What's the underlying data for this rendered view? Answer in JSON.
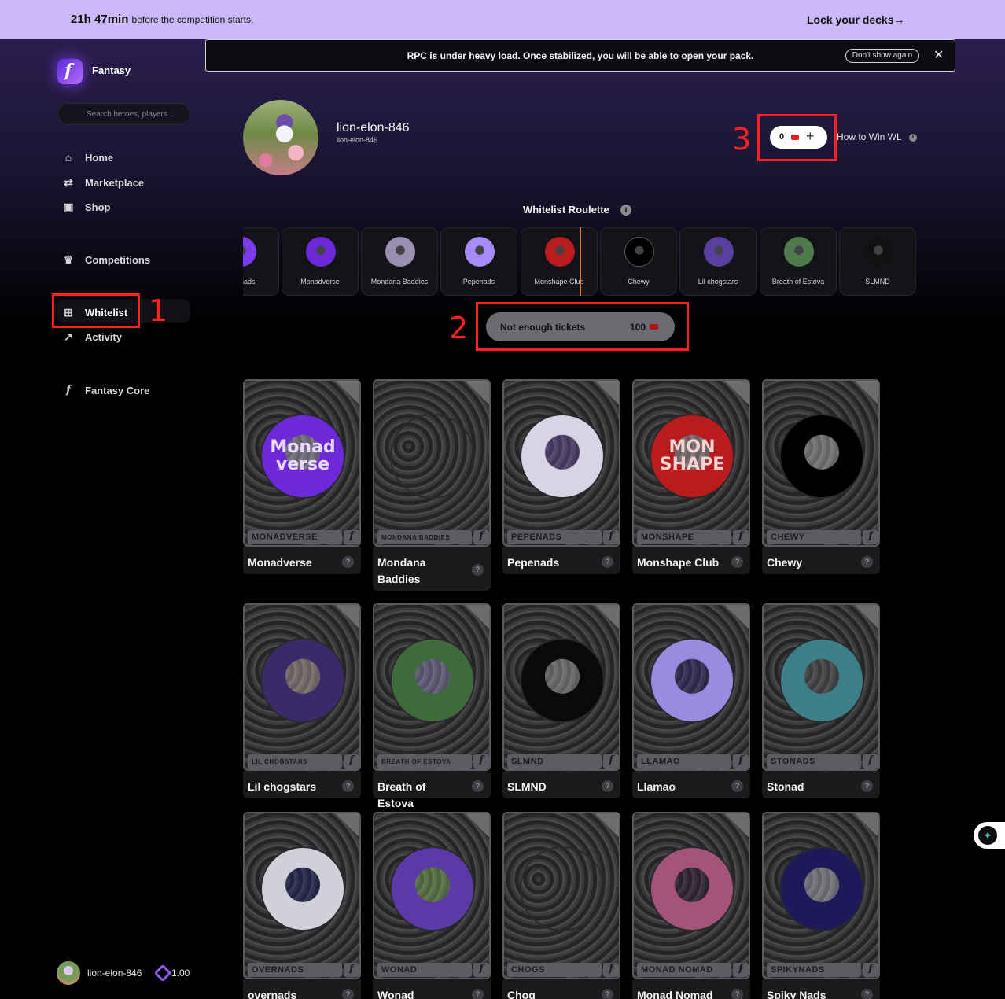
{
  "banner": {
    "countdown": "21h 47min",
    "countdown_suffix": "before the competition starts.",
    "lock_link": "Lock your decks→"
  },
  "sidebar": {
    "brand": "Fantasy",
    "search_placeholder": "Search heroes, players...",
    "nav": [
      {
        "label": "Home",
        "icon": "home-icon"
      },
      {
        "label": "Marketplace",
        "icon": "swap-icon"
      },
      {
        "label": "Shop",
        "icon": "shop-icon"
      },
      {
        "label": "Competitions",
        "icon": "trophy-icon"
      },
      {
        "label": "Whitelist",
        "icon": "gift-icon",
        "active": true
      },
      {
        "label": "Activity",
        "icon": "trending-icon"
      },
      {
        "label": "Fantasy Core",
        "icon": "fantasy-logo-icon"
      }
    ],
    "user": {
      "name": "lion-elon-846",
      "balance": "1.00"
    }
  },
  "notice": {
    "text": "RPC is under heavy load. Once stabilized, you will be able to open your pack.",
    "dismiss_label": "Don't show again",
    "close_glyph": "✕"
  },
  "profile": {
    "name": "lion-elon-846",
    "handle": "lion-elon-846",
    "tickets": "0",
    "plus_glyph": "+",
    "how_to_win": "How to Win WL"
  },
  "roulette": {
    "title": "Whitelist Roulette",
    "items": [
      {
        "name": "overnads",
        "color": "#7c3aed"
      },
      {
        "name": "Monadverse",
        "color": "#6d28d9"
      },
      {
        "name": "Mondana Baddies",
        "color": "#9a8fb0"
      },
      {
        "name": "Pepenads",
        "color": "#a78bfa"
      },
      {
        "name": "Monshape Club",
        "color": "#b91c1c"
      },
      {
        "name": "Chewy",
        "color": "#000000"
      },
      {
        "name": "Lil chogstars",
        "color": "#5b3fa0"
      },
      {
        "name": "Breath of Estova",
        "color": "#4d7c4a"
      },
      {
        "name": "SLMND",
        "color": "#111111"
      }
    ],
    "button_label": "Not enough tickets",
    "button_cost": "100"
  },
  "annotations": [
    "1",
    "2",
    "3"
  ],
  "collections": [
    {
      "name": "Monadverse",
      "plate": "MONADVERSE",
      "art": "Monad verse",
      "bg": "#6d28d9",
      "fg": "#e5d9ff"
    },
    {
      "name": "Mondana Baddies",
      "plate": "MONDANA BADDIES",
      "art": "",
      "bg": "#b5a8c4",
      "fg": "#222"
    },
    {
      "name": "Pepenads",
      "plate": "PEPENADS",
      "art": "",
      "bg": "#d9d4e4",
      "fg": "#7c5cc4"
    },
    {
      "name": "Monshape Club",
      "plate": "MONSHAPE",
      "art": "MON SHAPE",
      "bg": "#b91c1c",
      "fg": "#f4d4d4"
    },
    {
      "name": "Chewy",
      "plate": "CHEWY",
      "art": "",
      "bg": "#000000",
      "fg": "#e5e5e5"
    },
    {
      "name": "Lil chogstars",
      "plate": "LIL CHOGSTARS",
      "art": "",
      "bg": "#3b2a6a",
      "fg": "#f0d6c8"
    },
    {
      "name": "Breath of Estova",
      "plate": "BREATH OF ESTOVA",
      "art": "",
      "bg": "#3f6b3a",
      "fg": "#b0a8e8"
    },
    {
      "name": "SLMND",
      "plate": "SLMND",
      "art": "",
      "bg": "#0a0a0a",
      "fg": "#cfcfcf"
    },
    {
      "name": "Llamao",
      "plate": "LLAMAO",
      "art": "",
      "bg": "#9a8ae0",
      "fg": "#3b2a8a"
    },
    {
      "name": "Stonad",
      "plate": "STONADS",
      "art": "",
      "bg": "#3c7f86",
      "fg": "#6b6b6b"
    },
    {
      "name": "overnads",
      "plate": "OVERNADS",
      "art": "",
      "bg": "#d0d0d8",
      "fg": "#1e1e7a"
    },
    {
      "name": "Wonad",
      "plate": "WONAD",
      "art": "",
      "bg": "#5b3aa8",
      "fg": "#a0e060"
    },
    {
      "name": "Chog",
      "plate": "CHOGS",
      "art": "",
      "bg": "#f2ecd0",
      "fg": "#111"
    },
    {
      "name": "Monad Nomad",
      "plate": "MONAD NOMAD",
      "art": "",
      "bg": "#a4547a",
      "fg": "#3a1a3a"
    },
    {
      "name": "Spiky Nads",
      "plate": "SPIKYNADS",
      "art": "",
      "bg": "#1e1a5a",
      "fg": "#e8e8f4"
    }
  ],
  "card_help_glyph": "?",
  "card_logo_glyph": "f",
  "wl_tag": "WL"
}
